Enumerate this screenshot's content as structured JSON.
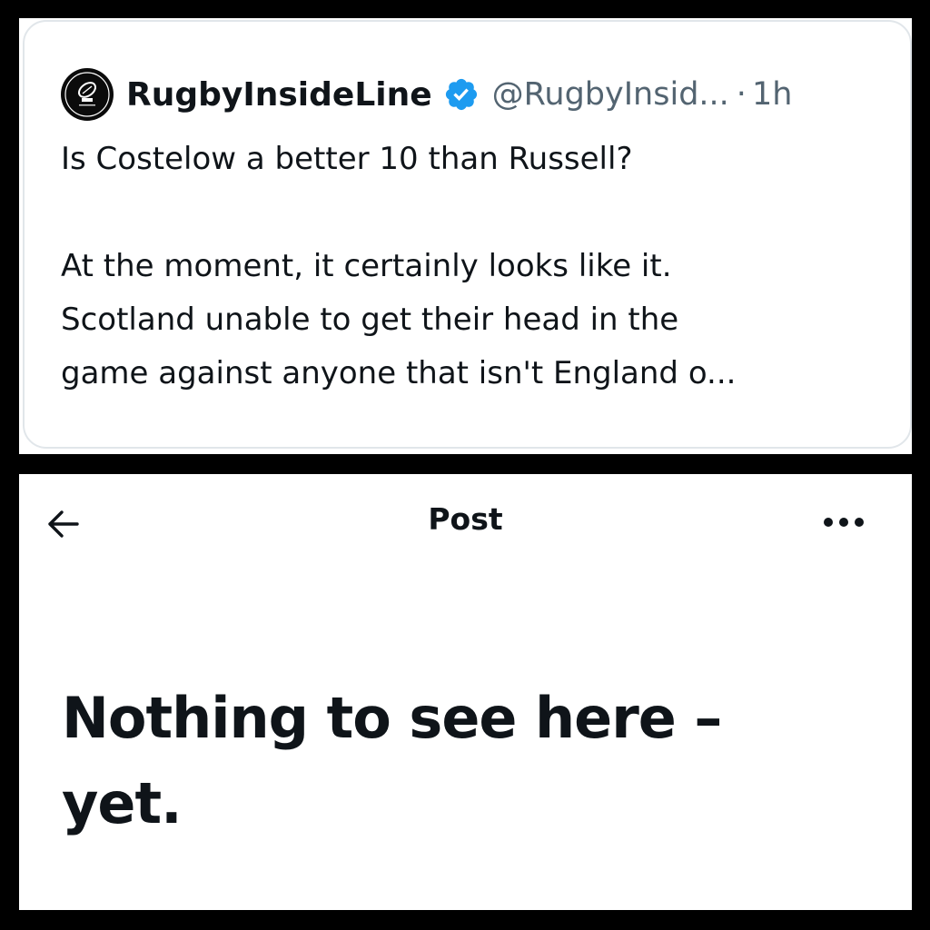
{
  "quote_tweet": {
    "display_name": "RugbyInsideLine",
    "handle": "@RugbyInsid...",
    "separator": "·",
    "timestamp": "1h",
    "avatar_icon": "rugby-inside-line-logo",
    "verified_icon": "verified-badge-icon",
    "verified_color": "#1d9bf0",
    "body_line_1": "Is Costelow a better 10 than Russell?",
    "body_line_2": "At the moment, it certainly looks like it.",
    "body_line_3": "Scotland unable to get their head in the",
    "body_line_4": "game against anyone that isn't England o..."
  },
  "post_screen": {
    "title": "Post",
    "back_icon": "arrow-left-icon",
    "more_icon": "more-options-icon",
    "empty_line_1": "Nothing to see here –",
    "empty_line_2": "yet."
  },
  "colors": {
    "frame": "#000000",
    "text_primary": "#0f1419",
    "text_secondary": "#536471",
    "card_border": "#e1e6ea"
  }
}
